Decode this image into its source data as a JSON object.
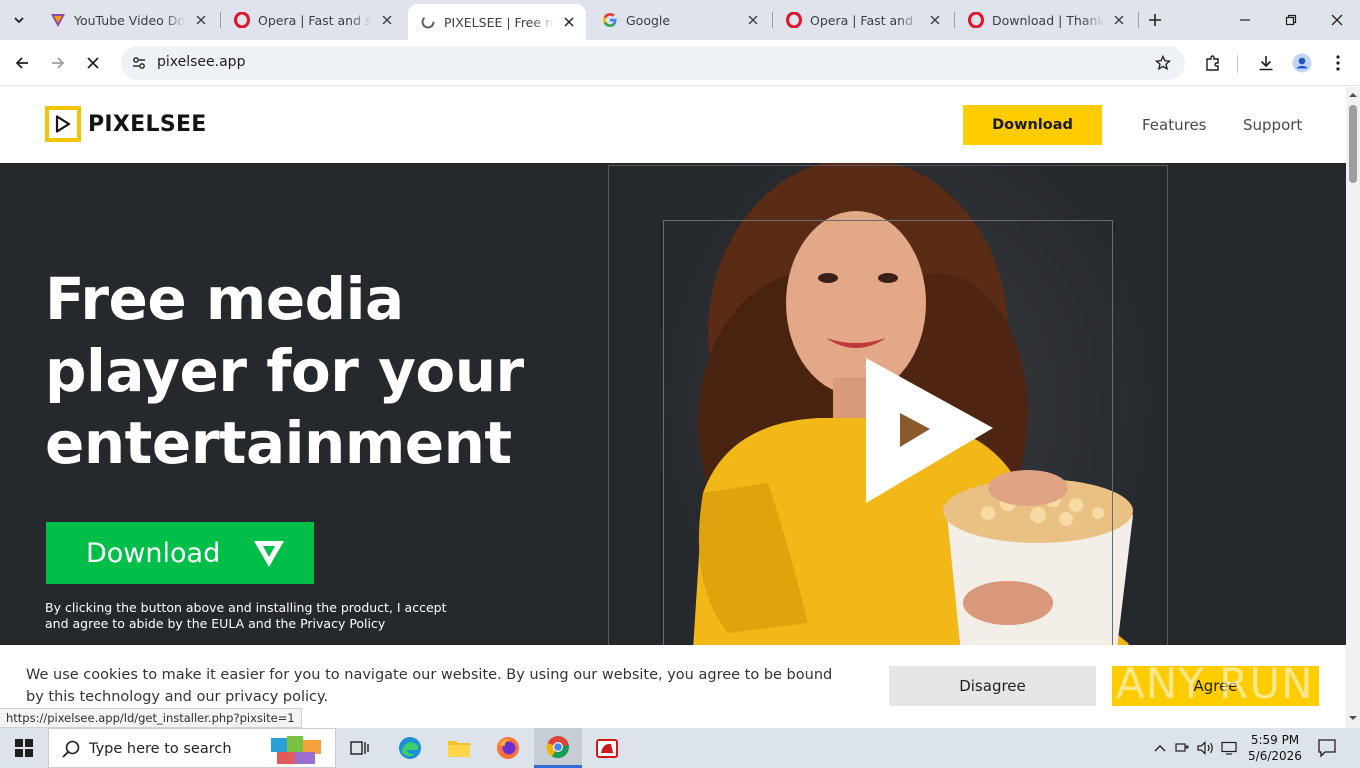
{
  "browser": {
    "tabs": [
      {
        "title": "YouTube Video Downloader",
        "favicon": "youtube-downloader-icon",
        "active": false
      },
      {
        "title": "Opera | Fast and secure",
        "favicon": "opera-icon",
        "active": false
      },
      {
        "title": "PIXELSEE | Free media player",
        "favicon": "loading-spinner-icon",
        "active": true
      },
      {
        "title": "Google",
        "favicon": "google-icon",
        "active": false
      },
      {
        "title": "Opera | Fast and secure",
        "favicon": "opera-icon",
        "active": false
      },
      {
        "title": "Download | Thanks for",
        "favicon": "opera-icon",
        "active": false
      }
    ],
    "address": "pixelsee.app",
    "status_url": "https://pixelsee.app/ld/get_installer.php?pixsite=1"
  },
  "site": {
    "logo_text": "PIXELSEE",
    "nav": {
      "download": "Download",
      "features": "Features",
      "support": "Support"
    },
    "hero": {
      "title_line1": "Free media",
      "title_line2": "player for your",
      "title_line3": "entertainment",
      "download_label": "Download",
      "note": "By clicking the button above and installing the product, I accept and agree to abide by the EULA and the Privacy Policy"
    },
    "cookie": {
      "text": "We use cookies to make it easier for you to navigate our website. By using our website, you agree to be bound by this technology and our privacy policy.",
      "disagree": "Disagree",
      "agree": "Agree"
    },
    "watermark": "ANY RUN"
  },
  "taskbar": {
    "search_placeholder": "Type here to search",
    "time": "5:59 PM",
    "date": "5/6/2026"
  },
  "colors": {
    "brand_yellow": "#ffcc00",
    "hero_bg": "#25282c",
    "download_green": "#00bf49",
    "tabstrip_bg": "#dfe3eb"
  }
}
